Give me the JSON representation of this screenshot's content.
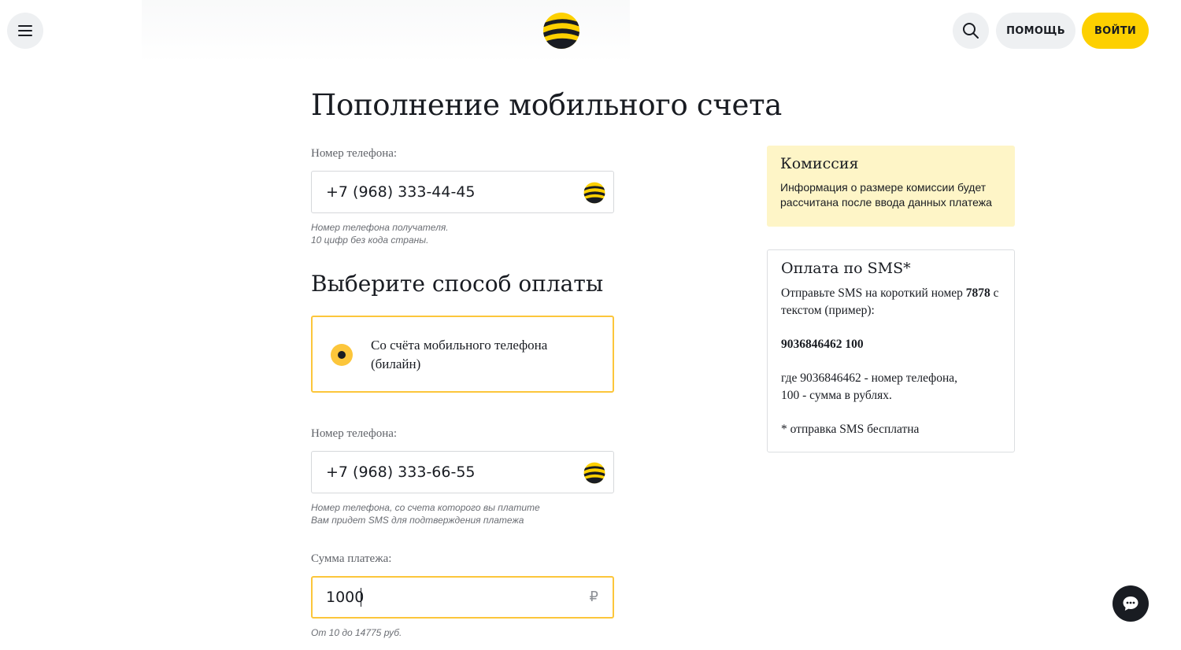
{
  "header": {
    "help_label": "ПОМОЩЬ",
    "login_label": "ВОЙТИ",
    "menu_icon": "hamburger-icon",
    "search_icon": "search-icon",
    "logo_icon": "beeline-logo-icon"
  },
  "main": {
    "title": "Пополнение мобильного счета",
    "recipient": {
      "label": "Номер телефона:",
      "value": "+7 (968) 333-44-45",
      "hint_line1": "Номер телефона получателя.",
      "hint_line2": "10 цифр без кода страны."
    },
    "payment_method": {
      "title": "Выберите способ оплаты",
      "option_label": "Со счёта мобильного телефона (билайн)",
      "selected": true
    },
    "payer": {
      "label": "Номер телефона:",
      "value": "+7 (968) 333-66-55",
      "hint_line1": "Номер телефона, со счета которого вы платите",
      "hint_line2": "Вам придет SMS для подтверждения платежа"
    },
    "amount": {
      "label": "Сумма платежа:",
      "value": "1000",
      "currency": "₽",
      "hint": "От 10 до 14775 руб."
    }
  },
  "sidebar": {
    "commission": {
      "title": "Комиссия",
      "text": "Информация о размере комиссии будет рассчитана после ввода данных платежа"
    },
    "sms": {
      "title": "Оплата по SMS*",
      "text_before": "Отправьте SMS на короткий номер ",
      "short_number": "7878",
      "text_after": " с текстом (пример):",
      "example": "9036846462 100",
      "explain_line1": "где 9036846462 - номер телефона,",
      "explain_line2": "100 - сумма в рублях.",
      "note": "* отправка SMS бесплатна"
    }
  },
  "chat": {
    "icon": "chat-bubble-icon"
  },
  "colors": {
    "brand_yellow": "#fdd000",
    "accent_border": "#fcc63b",
    "commission_bg": "#fef5c7",
    "text": "#191c22",
    "button_gray": "#eef0f2"
  }
}
